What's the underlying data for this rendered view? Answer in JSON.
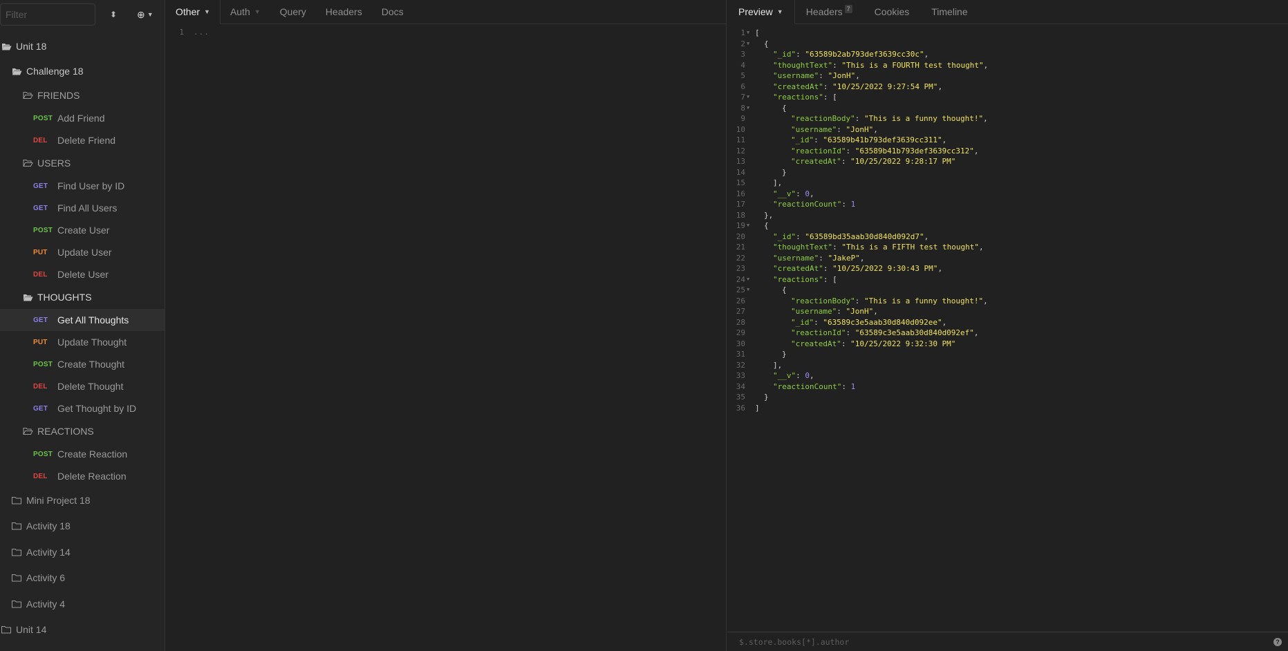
{
  "sidebar": {
    "filter_placeholder": "Filter",
    "sort_icon": "⬍",
    "add_icon": "⊕",
    "tree": [
      {
        "type": "folder",
        "level": 0,
        "open": true,
        "label": "Unit 18"
      },
      {
        "type": "folder",
        "level": 1,
        "open": true,
        "label": "Challenge 18"
      },
      {
        "type": "folder",
        "level": 2,
        "open": false,
        "label": "FRIENDS"
      },
      {
        "type": "request",
        "method": "POST",
        "label": "Add Friend"
      },
      {
        "type": "request",
        "method": "DEL",
        "label": "Delete Friend"
      },
      {
        "type": "folder",
        "level": 2,
        "open": false,
        "label": "USERS"
      },
      {
        "type": "request",
        "method": "GET",
        "label": "Find User by ID"
      },
      {
        "type": "request",
        "method": "GET",
        "label": "Find All Users"
      },
      {
        "type": "request",
        "method": "POST",
        "label": "Create User"
      },
      {
        "type": "request",
        "method": "PUT",
        "label": "Update User"
      },
      {
        "type": "request",
        "method": "DEL",
        "label": "Delete User"
      },
      {
        "type": "folder",
        "level": 2,
        "open": true,
        "label": "THOUGHTS"
      },
      {
        "type": "request",
        "method": "GET",
        "label": "Get All Thoughts",
        "active": true
      },
      {
        "type": "request",
        "method": "PUT",
        "label": "Update Thought"
      },
      {
        "type": "request",
        "method": "POST",
        "label": "Create Thought"
      },
      {
        "type": "request",
        "method": "DEL",
        "label": "Delete Thought"
      },
      {
        "type": "request",
        "method": "GET",
        "label": "Get Thought by ID"
      },
      {
        "type": "folder",
        "level": 2,
        "open": false,
        "label": "REACTIONS"
      },
      {
        "type": "request",
        "method": "POST",
        "label": "Create Reaction"
      },
      {
        "type": "request",
        "method": "DEL",
        "label": "Delete Reaction"
      },
      {
        "type": "folder",
        "level": 1,
        "open": false,
        "closed": true,
        "label": "Mini Project 18"
      },
      {
        "type": "folder",
        "level": 1,
        "open": false,
        "closed": true,
        "label": "Activity 18"
      },
      {
        "type": "folder",
        "level": 1,
        "open": false,
        "closed": true,
        "label": "Activity 14"
      },
      {
        "type": "folder",
        "level": 1,
        "open": false,
        "closed": true,
        "label": "Activity 6"
      },
      {
        "type": "folder",
        "level": 1,
        "open": false,
        "closed": true,
        "label": "Activity 4"
      },
      {
        "type": "folder",
        "level": 0,
        "open": false,
        "closed": true,
        "label": "Unit 14"
      }
    ]
  },
  "request": {
    "tabs": [
      {
        "label": "Other",
        "active": true,
        "caret": true
      },
      {
        "label": "Auth",
        "caret": true,
        "dim": true
      },
      {
        "label": "Query"
      },
      {
        "label": "Headers"
      },
      {
        "label": "Docs"
      }
    ],
    "editor": {
      "line_number": "1",
      "content": "..."
    }
  },
  "response": {
    "tabs": [
      {
        "label": "Preview",
        "active": true,
        "caret": true
      },
      {
        "label": "Headers",
        "badge": "7"
      },
      {
        "label": "Cookies"
      },
      {
        "label": "Timeline"
      }
    ],
    "lines": [
      {
        "n": "1",
        "fold": true,
        "indent": 0,
        "tokens": [
          [
            "p",
            "["
          ]
        ]
      },
      {
        "n": "2",
        "fold": true,
        "indent": 1,
        "tokens": [
          [
            "p",
            "{"
          ]
        ]
      },
      {
        "n": "3",
        "indent": 2,
        "tokens": [
          [
            "k",
            "\"_id\""
          ],
          [
            "p",
            ": "
          ],
          [
            "s",
            "\"63589b2ab793def3639cc30c\""
          ],
          [
            "p",
            ","
          ]
        ]
      },
      {
        "n": "4",
        "indent": 2,
        "tokens": [
          [
            "k",
            "\"thoughtText\""
          ],
          [
            "p",
            ": "
          ],
          [
            "s",
            "\"This is a FOURTH test thought\""
          ],
          [
            "p",
            ","
          ]
        ]
      },
      {
        "n": "5",
        "indent": 2,
        "tokens": [
          [
            "k",
            "\"username\""
          ],
          [
            "p",
            ": "
          ],
          [
            "s",
            "\"JonH\""
          ],
          [
            "p",
            ","
          ]
        ]
      },
      {
        "n": "6",
        "indent": 2,
        "tokens": [
          [
            "k",
            "\"createdAt\""
          ],
          [
            "p",
            ": "
          ],
          [
            "s",
            "\"10/25/2022 9:27:54 PM\""
          ],
          [
            "p",
            ","
          ]
        ]
      },
      {
        "n": "7",
        "fold": true,
        "indent": 2,
        "tokens": [
          [
            "k",
            "\"reactions\""
          ],
          [
            "p",
            ": ["
          ]
        ]
      },
      {
        "n": "8",
        "fold": true,
        "indent": 3,
        "tokens": [
          [
            "p",
            "{"
          ]
        ]
      },
      {
        "n": "9",
        "indent": 4,
        "tokens": [
          [
            "k",
            "\"reactionBody\""
          ],
          [
            "p",
            ": "
          ],
          [
            "s",
            "\"This is a funny thought!\""
          ],
          [
            "p",
            ","
          ]
        ]
      },
      {
        "n": "10",
        "indent": 4,
        "tokens": [
          [
            "k",
            "\"username\""
          ],
          [
            "p",
            ": "
          ],
          [
            "s",
            "\"JonH\""
          ],
          [
            "p",
            ","
          ]
        ]
      },
      {
        "n": "11",
        "indent": 4,
        "tokens": [
          [
            "k",
            "\"_id\""
          ],
          [
            "p",
            ": "
          ],
          [
            "s",
            "\"63589b41b793def3639cc311\""
          ],
          [
            "p",
            ","
          ]
        ]
      },
      {
        "n": "12",
        "indent": 4,
        "tokens": [
          [
            "k",
            "\"reactionId\""
          ],
          [
            "p",
            ": "
          ],
          [
            "s",
            "\"63589b41b793def3639cc312\""
          ],
          [
            "p",
            ","
          ]
        ]
      },
      {
        "n": "13",
        "indent": 4,
        "tokens": [
          [
            "k",
            "\"createdAt\""
          ],
          [
            "p",
            ": "
          ],
          [
            "s",
            "\"10/25/2022 9:28:17 PM\""
          ]
        ]
      },
      {
        "n": "14",
        "indent": 3,
        "tokens": [
          [
            "p",
            "}"
          ]
        ]
      },
      {
        "n": "15",
        "indent": 2,
        "tokens": [
          [
            "p",
            "],"
          ]
        ]
      },
      {
        "n": "16",
        "indent": 2,
        "tokens": [
          [
            "k",
            "\"__v\""
          ],
          [
            "p",
            ": "
          ],
          [
            "n",
            "0"
          ],
          [
            "p",
            ","
          ]
        ]
      },
      {
        "n": "17",
        "indent": 2,
        "tokens": [
          [
            "k",
            "\"reactionCount\""
          ],
          [
            "p",
            ": "
          ],
          [
            "n",
            "1"
          ]
        ]
      },
      {
        "n": "18",
        "indent": 1,
        "tokens": [
          [
            "p",
            "},"
          ]
        ]
      },
      {
        "n": "19",
        "fold": true,
        "indent": 1,
        "tokens": [
          [
            "p",
            "{"
          ]
        ]
      },
      {
        "n": "20",
        "indent": 2,
        "tokens": [
          [
            "k",
            "\"_id\""
          ],
          [
            "p",
            ": "
          ],
          [
            "s",
            "\"63589bd35aab30d840d092d7\""
          ],
          [
            "p",
            ","
          ]
        ]
      },
      {
        "n": "21",
        "indent": 2,
        "tokens": [
          [
            "k",
            "\"thoughtText\""
          ],
          [
            "p",
            ": "
          ],
          [
            "s",
            "\"This is a FIFTH test thought\""
          ],
          [
            "p",
            ","
          ]
        ]
      },
      {
        "n": "22",
        "indent": 2,
        "tokens": [
          [
            "k",
            "\"username\""
          ],
          [
            "p",
            ": "
          ],
          [
            "s",
            "\"JakeP\""
          ],
          [
            "p",
            ","
          ]
        ]
      },
      {
        "n": "23",
        "indent": 2,
        "tokens": [
          [
            "k",
            "\"createdAt\""
          ],
          [
            "p",
            ": "
          ],
          [
            "s",
            "\"10/25/2022 9:30:43 PM\""
          ],
          [
            "p",
            ","
          ]
        ]
      },
      {
        "n": "24",
        "fold": true,
        "indent": 2,
        "tokens": [
          [
            "k",
            "\"reactions\""
          ],
          [
            "p",
            ": ["
          ]
        ]
      },
      {
        "n": "25",
        "fold": true,
        "indent": 3,
        "tokens": [
          [
            "p",
            "{"
          ]
        ]
      },
      {
        "n": "26",
        "indent": 4,
        "tokens": [
          [
            "k",
            "\"reactionBody\""
          ],
          [
            "p",
            ": "
          ],
          [
            "s",
            "\"This is a funny thought!\""
          ],
          [
            "p",
            ","
          ]
        ]
      },
      {
        "n": "27",
        "indent": 4,
        "tokens": [
          [
            "k",
            "\"username\""
          ],
          [
            "p",
            ": "
          ],
          [
            "s",
            "\"JonH\""
          ],
          [
            "p",
            ","
          ]
        ]
      },
      {
        "n": "28",
        "indent": 4,
        "tokens": [
          [
            "k",
            "\"_id\""
          ],
          [
            "p",
            ": "
          ],
          [
            "s",
            "\"63589c3e5aab30d840d092ee\""
          ],
          [
            "p",
            ","
          ]
        ]
      },
      {
        "n": "29",
        "indent": 4,
        "tokens": [
          [
            "k",
            "\"reactionId\""
          ],
          [
            "p",
            ": "
          ],
          [
            "s",
            "\"63589c3e5aab30d840d092ef\""
          ],
          [
            "p",
            ","
          ]
        ]
      },
      {
        "n": "30",
        "indent": 4,
        "tokens": [
          [
            "k",
            "\"createdAt\""
          ],
          [
            "p",
            ": "
          ],
          [
            "s",
            "\"10/25/2022 9:32:30 PM\""
          ]
        ]
      },
      {
        "n": "31",
        "indent": 3,
        "tokens": [
          [
            "p",
            "}"
          ]
        ]
      },
      {
        "n": "32",
        "indent": 2,
        "tokens": [
          [
            "p",
            "],"
          ]
        ]
      },
      {
        "n": "33",
        "indent": 2,
        "tokens": [
          [
            "k",
            "\"__v\""
          ],
          [
            "p",
            ": "
          ],
          [
            "n",
            "0"
          ],
          [
            "p",
            ","
          ]
        ]
      },
      {
        "n": "34",
        "indent": 2,
        "tokens": [
          [
            "k",
            "\"reactionCount\""
          ],
          [
            "p",
            ": "
          ],
          [
            "n",
            "1"
          ]
        ]
      },
      {
        "n": "35",
        "indent": 1,
        "tokens": [
          [
            "p",
            "}"
          ]
        ]
      },
      {
        "n": "36",
        "indent": 0,
        "tokens": [
          [
            "p",
            "]"
          ]
        ]
      }
    ],
    "filter_placeholder": "$.store.books[*].author",
    "help_icon": "?"
  },
  "colors": {
    "GET": "#8b7fe8",
    "POST": "#6bc34a",
    "PUT": "#f28a35",
    "DEL": "#e14545",
    "json_key": "#8fce3e",
    "json_string": "#f0e25c",
    "json_number": "#9c8cf0"
  }
}
